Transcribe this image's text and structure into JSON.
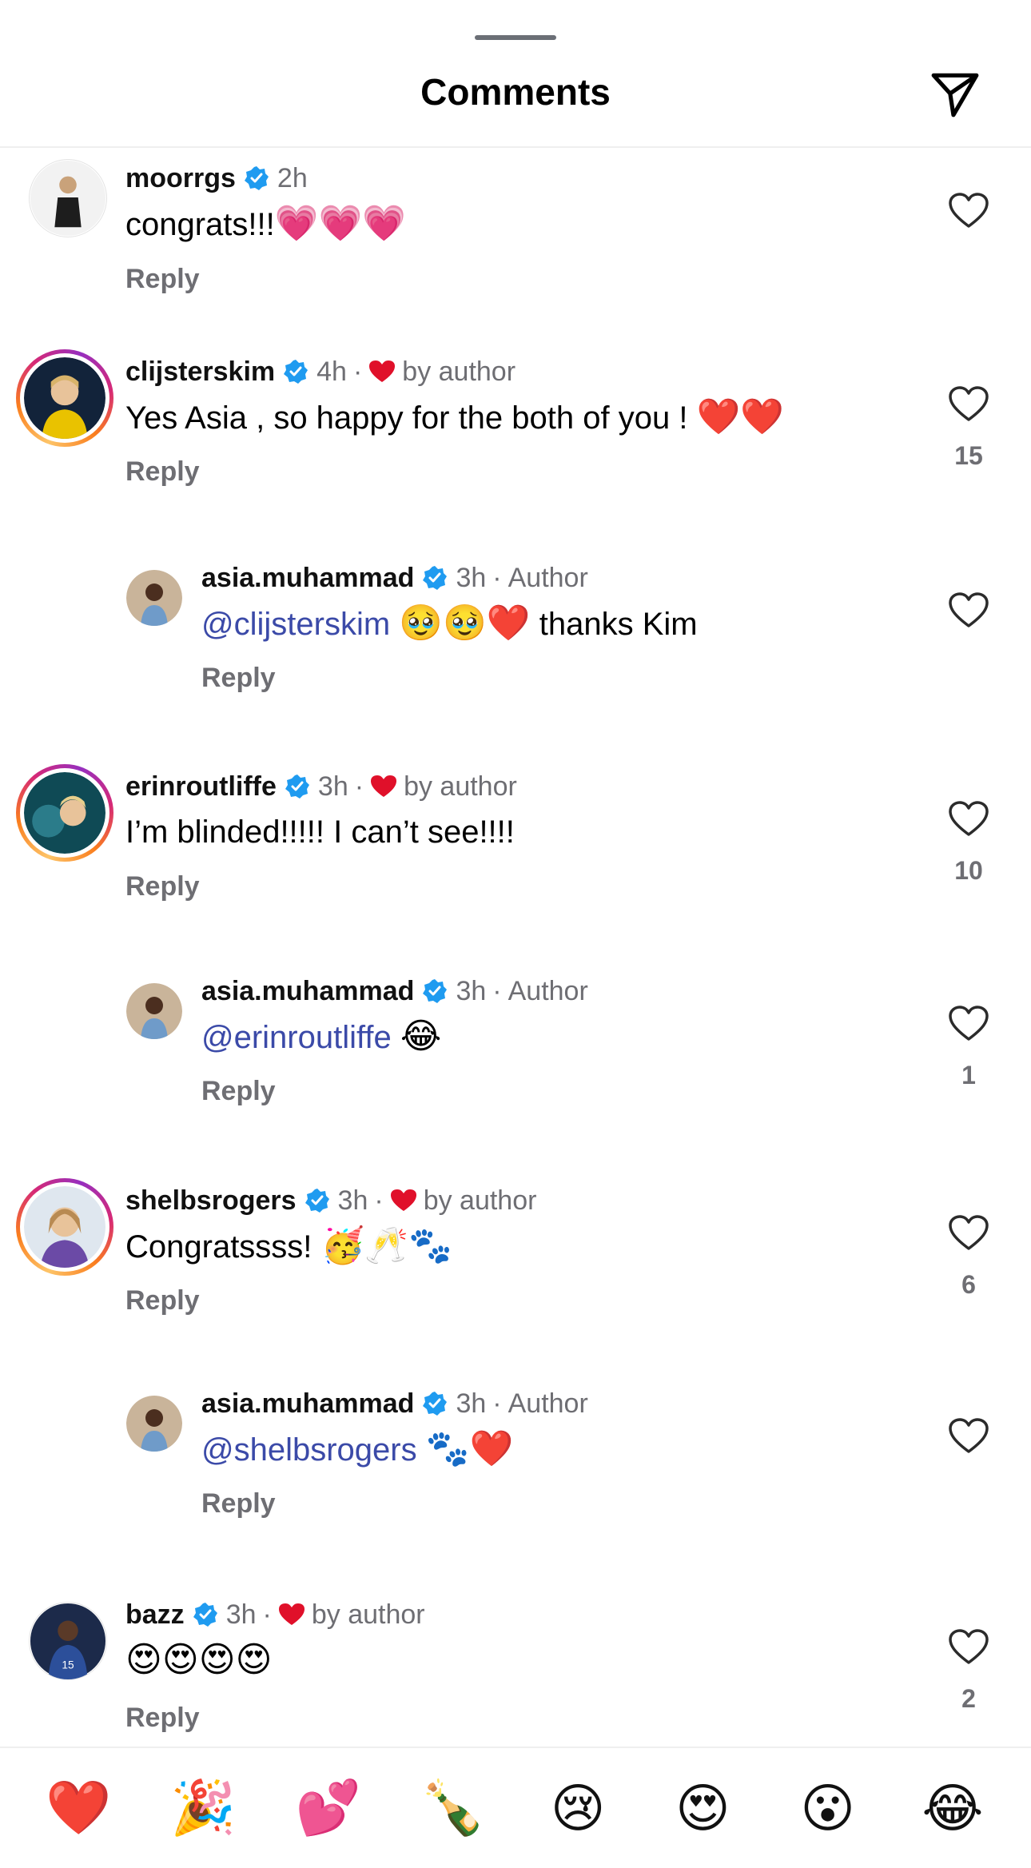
{
  "header": {
    "title": "Comments"
  },
  "colors": {
    "verified": "#1f9bf0",
    "heart_red": "#e0102a",
    "mention": "#3b4aa8",
    "muted": "#6e6e73"
  },
  "comments": [
    {
      "username": "moorrgs",
      "time": "2h",
      "liked_by_author": false,
      "by_author_label": "",
      "text": "congrats!!!",
      "emoji": "💗💗💗",
      "mention": "",
      "reply_label": "Reply",
      "like_count": "",
      "is_reply": false,
      "ring": false
    },
    {
      "username": "clijsterskim",
      "time": "4h",
      "liked_by_author": true,
      "by_author_label": "by author",
      "text": "Yes Asia , so happy for the both of you ! ",
      "emoji": "❤️❤️",
      "mention": "",
      "reply_label": "Reply",
      "like_count": "15",
      "is_reply": false,
      "ring": true
    },
    {
      "username": "asia.muhammad",
      "time": "3h",
      "author_label": "Author",
      "mention": "@clijsterskim",
      "emoji": "🥹🥹❤️",
      "text": " thanks Kim",
      "reply_label": "Reply",
      "like_count": "",
      "is_reply": true
    },
    {
      "username": "erinroutliffe",
      "time": "3h",
      "liked_by_author": true,
      "by_author_label": "by author",
      "text": "I’m blinded!!!!! I can’t see!!!!",
      "emoji": "",
      "mention": "",
      "reply_label": "Reply",
      "like_count": "10",
      "is_reply": false,
      "ring": true
    },
    {
      "username": "asia.muhammad",
      "time": "3h",
      "author_label": "Author",
      "mention": "@erinroutliffe",
      "emoji": "😂",
      "text": "",
      "reply_label": "Reply",
      "like_count": "1",
      "is_reply": true
    },
    {
      "username": "shelbsrogers",
      "time": "3h",
      "liked_by_author": true,
      "by_author_label": "by author",
      "text": "Congratssss! ",
      "emoji": "🥳🥂🐾",
      "mention": "",
      "reply_label": "Reply",
      "like_count": "6",
      "is_reply": false,
      "ring": true
    },
    {
      "username": "asia.muhammad",
      "time": "3h",
      "author_label": "Author",
      "mention": "@shelbsrogers",
      "emoji": "🐾❤️",
      "text": "",
      "reply_label": "Reply",
      "like_count": "",
      "is_reply": true
    },
    {
      "username": "bazz",
      "time": "3h",
      "liked_by_author": true,
      "by_author_label": "by author",
      "text": "",
      "emoji": "😍😍😍😍",
      "mention": "",
      "reply_label": "Reply",
      "like_count": "2",
      "is_reply": false,
      "ring": false
    }
  ],
  "emoji_bar": [
    "❤️",
    "🎉",
    "💕",
    "🍾",
    "😢",
    "😍",
    "😮",
    "😂"
  ],
  "icons": {
    "send": "send-icon",
    "verified": "verified-badge-icon",
    "heart": "heart-outline-icon"
  }
}
